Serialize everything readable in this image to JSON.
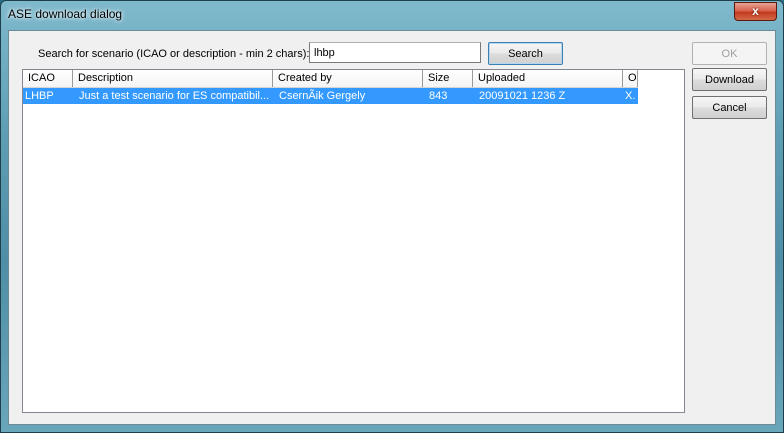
{
  "window": {
    "title": "ASE download dialog",
    "close_glyph": "x"
  },
  "search": {
    "label": "Search for scenario (ICAO or description - min 2 chars):",
    "value": "lhbp",
    "button_label": "Search"
  },
  "buttons": {
    "ok_label": "OK",
    "download_label": "Download",
    "cancel_label": "Cancel"
  },
  "list": {
    "columns": [
      "ICAO",
      "Description",
      "Created by",
      "Size",
      "Uploaded",
      "O"
    ],
    "rows": [
      {
        "icao": "LHBP",
        "description": "Just a test scenario for ES compatibil...",
        "created_by": "CsernÃik Gergely",
        "size": "843",
        "uploaded": "20091021 1236 Z",
        "o": "X.",
        "selected": true
      }
    ]
  },
  "colors": {
    "selection": "#3399ff",
    "close_button": "#c23a20",
    "window_frame": "#5f9fb5"
  }
}
